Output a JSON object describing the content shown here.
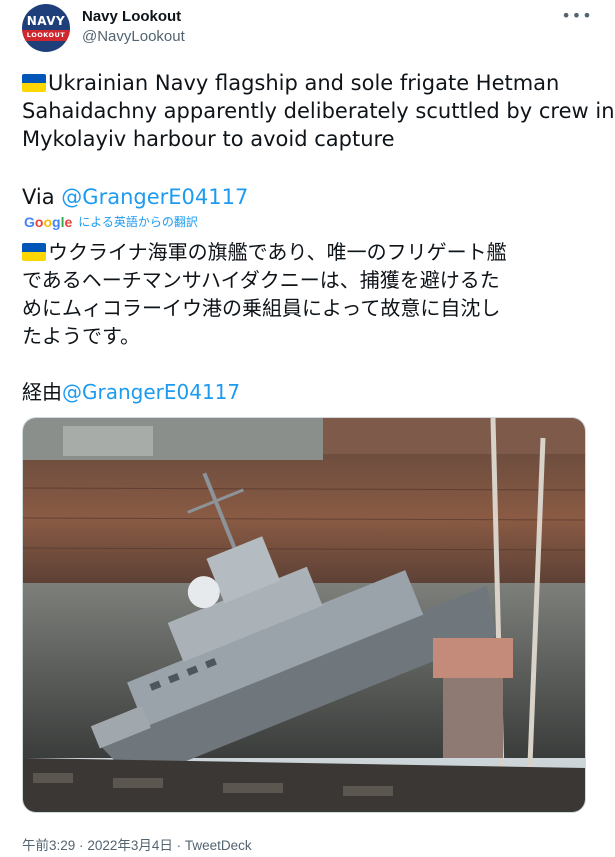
{
  "author": {
    "display_name": "Navy Lookout",
    "handle": "@NavyLookout",
    "avatar": {
      "line1": "NAVY",
      "line2": "LOOKOUT",
      "bg": "#1f3f7a",
      "accent": "#d0262d"
    }
  },
  "more_icon": "more-horizontal-icon",
  "flag_icon": "ukraine-flag-emoji",
  "tweet": {
    "lines": [
      "Ukrainian Navy flagship and sole frigate Hetman",
      "Sahaidachny apparently deliberately scuttled by crew in",
      "Mykolayiv harbour to avoid capture"
    ],
    "via_prefix": "Via ",
    "mention": "@GrangerE04117"
  },
  "translation": {
    "provider": "Google",
    "label": "による英語からの翻訳",
    "lines": [
      "ウクライナ海軍の旗艦であり、唯一のフリゲート艦",
      "であるヘーチマンサハイダクニーは、捕獲を避けるた",
      "めにムィコラーイウ港の乗組員によって故意に自沈し",
      "たようです。"
    ],
    "via_prefix": "経由",
    "mention": "@GrangerE04117"
  },
  "meta": {
    "time": "午前3:29",
    "date": "2022年3月4日",
    "source": "TweetDeck",
    "separator": "·"
  },
  "colors": {
    "link": "#1d9bf0",
    "text": "#0f1419",
    "secondary": "#536471"
  }
}
